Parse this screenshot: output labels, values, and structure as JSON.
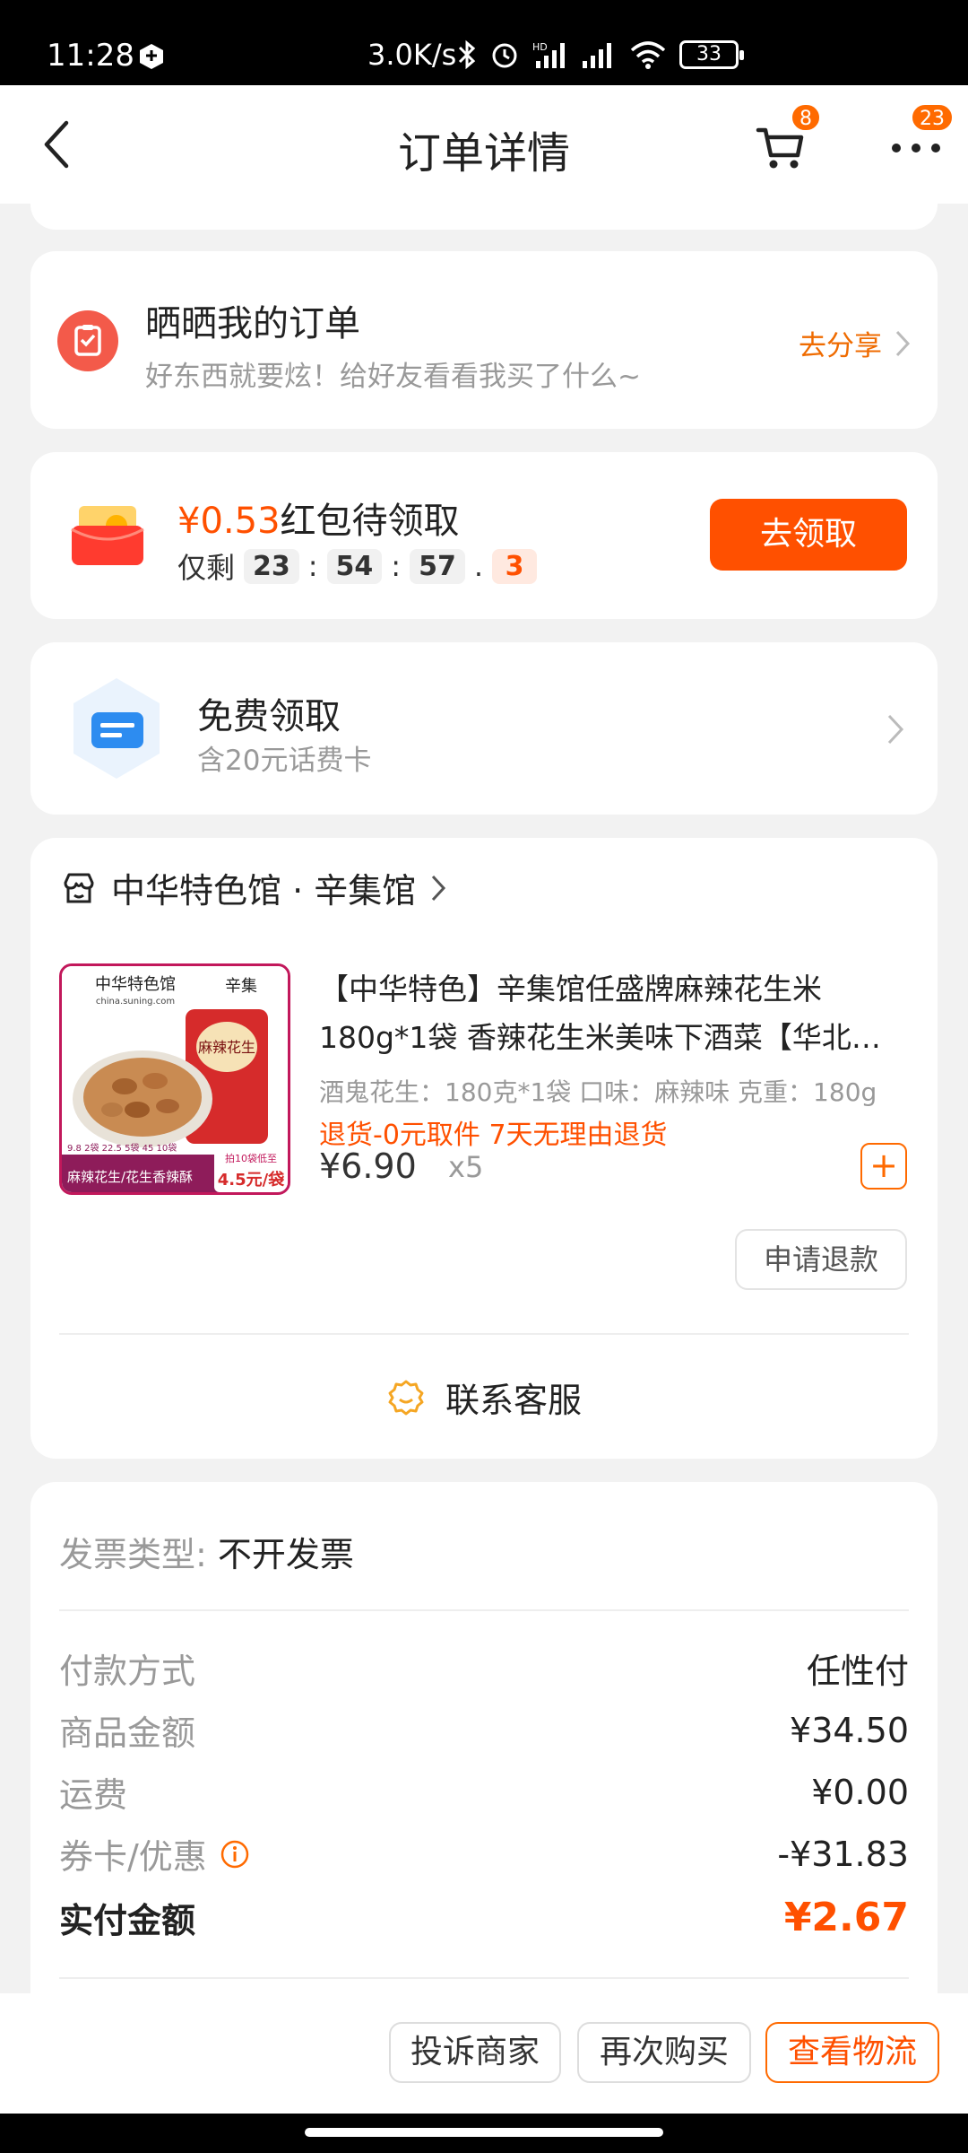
{
  "status_bar": {
    "time": "11:28",
    "speed": "3.0K/s",
    "battery": "33",
    "signal_label": "HD"
  },
  "header": {
    "title": "订单详情",
    "cart_badge": "8",
    "more_badge": "23"
  },
  "share": {
    "title": "晒晒我的订单",
    "subtitle": "好东西就要炫！给好友看看我买了什么~",
    "link": "去分享"
  },
  "red_packet": {
    "amount": "¥0.53",
    "label": "红包待领取",
    "remaining_label": "仅剩",
    "hours": "23",
    "minutes": "54",
    "seconds": "57",
    "tenths": "3",
    "sep_colon": ":",
    "sep_dot": ".",
    "button": "去领取"
  },
  "free_claim": {
    "title": "免费领取",
    "subtitle": "含20元话费卡"
  },
  "store": {
    "name": "中华特色馆 · 辛集馆"
  },
  "product": {
    "name": "【中华特色】辛集馆任盛牌麻辣花生米180g*1袋 香辣花生米美味下酒菜【华北…",
    "spec": "酒鬼花生：180克*1袋 口味：麻辣味 克重：180g",
    "tags": "退货-0元取件  7天无理由退货",
    "price": "¥6.90",
    "quantity": "x5",
    "refund_button": "申请退款",
    "image_text": {
      "brand": "中华特色馆",
      "site": "china.suning.com",
      "shop": "辛集",
      "pack": "麻辣花生",
      "promo": "拍10袋低至",
      "deal": "9.8 2袋 22.5 5袋 45 10袋",
      "bottom": "麻辣花生/花生香辣酥",
      "price": "4.5元/袋"
    }
  },
  "service": {
    "label": "联系客服"
  },
  "invoice": {
    "label": "发票类型:",
    "value": "不开发票"
  },
  "payment": {
    "rows": [
      {
        "label": "付款方式",
        "value": "任性付"
      },
      {
        "label": "商品金额",
        "value": "¥34.50"
      },
      {
        "label": "运费",
        "value": "¥0.00"
      },
      {
        "label": "券卡/优惠",
        "value": "-¥31.83"
      }
    ],
    "total_label": "实付金额",
    "total_value": "¥2.67"
  },
  "bottom_bar": {
    "complain": "投诉商家",
    "rebuy": "再次购买",
    "logistics": "查看物流"
  },
  "colors": {
    "accent": "#ff5000",
    "orange_text": "#ef6b00",
    "background": "#f2f2f2"
  }
}
